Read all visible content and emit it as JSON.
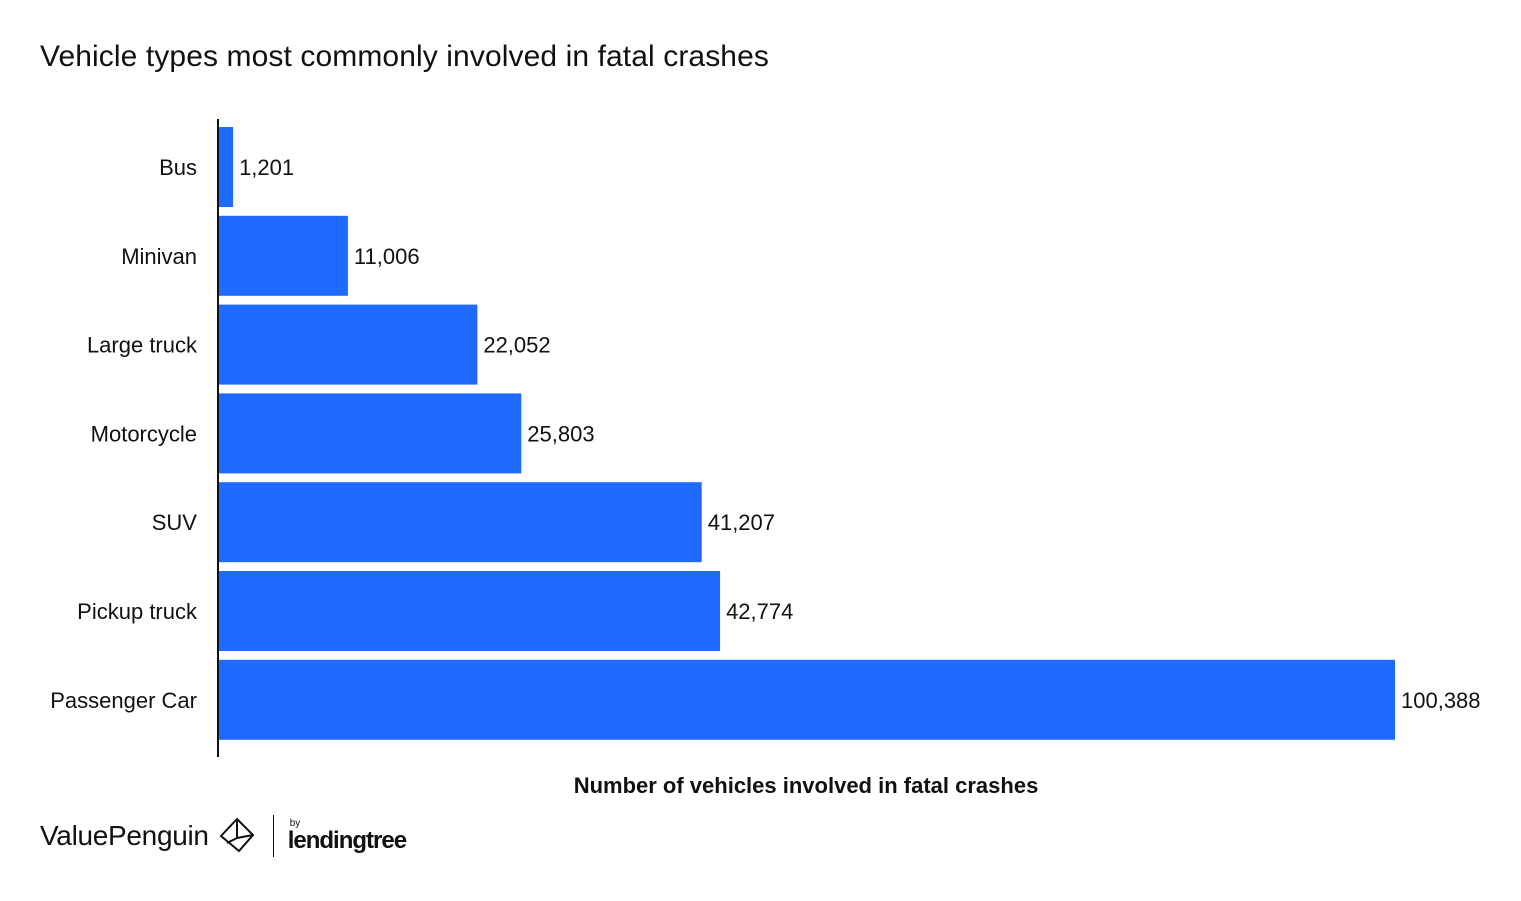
{
  "chart_data": {
    "type": "bar",
    "orientation": "horizontal",
    "title": "Vehicle types most commonly involved in fatal crashes",
    "xlabel": "Number of vehicles involved in fatal crashes",
    "ylabel": "",
    "categories": [
      "Bus",
      "Minivan",
      "Large truck",
      "Motorcycle",
      "SUV",
      "Pickup truck",
      "Passenger Car"
    ],
    "values": [
      1201,
      11006,
      22052,
      25803,
      41207,
      42774,
      100388
    ],
    "value_labels": [
      "1,201",
      "11,006",
      "22,052",
      "25,803",
      "41,207",
      "42,774",
      "100,388"
    ],
    "xlim": [
      0,
      100388
    ],
    "grid": false,
    "legend": "none",
    "bar_color": "#1f6bff"
  },
  "branding": {
    "logo_text": "ValuePenguin",
    "partner_by": "by",
    "partner_name": "lendingtree"
  }
}
